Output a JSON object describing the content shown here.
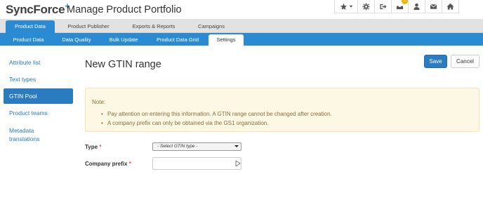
{
  "brand": {
    "name": "SyncForce",
    "plus": "+"
  },
  "app_title": "Manage Product Portfolio",
  "toolbar": {
    "items": [
      {
        "icon": "star-dropdown-icon"
      },
      {
        "icon": "gear-icon"
      },
      {
        "icon": "sign-out-icon"
      },
      {
        "icon": "inbox-icon",
        "badge": "1"
      },
      {
        "icon": "user-icon"
      },
      {
        "icon": "envelope-icon"
      },
      {
        "icon": "home-icon"
      }
    ]
  },
  "nav_primary": [
    "Product Data",
    "Product Publisher",
    "Exports & Reports",
    "Campaigns"
  ],
  "nav_secondary": [
    "Product Data",
    "Data Quality",
    "Bulk Update",
    "Product Data Grid",
    "Settings"
  ],
  "sidebar": [
    "Attribute list",
    "Text types",
    "GTIN Pool",
    "Product teams",
    "Metadata translations"
  ],
  "page_title": "New GTIN range",
  "buttons": {
    "save": "Save",
    "cancel": "Cancel"
  },
  "note": {
    "title": "Note:",
    "items": [
      "Pay attention on entering this information. A GTIN range cannot be changed after creation.",
      "A company prefix can only be obtained via the GS1 organization."
    ]
  },
  "form": {
    "type_label": "Type",
    "type_value": "- Select GTIN type -",
    "prefix_label": "Company prefix",
    "prefix_value": "",
    "required_mark": "*"
  },
  "colors": {
    "primary": "#2a8bd2",
    "sidebar_active": "#2a7bc0",
    "note_bg": "#fcf8e3",
    "note_text": "#8a6d3b",
    "required": "#d9534f"
  }
}
